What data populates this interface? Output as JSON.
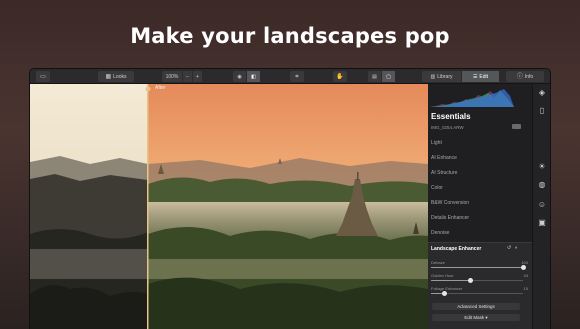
{
  "headline": "Make your landscapes pop",
  "toolbar": {
    "looks": "Looks",
    "zoom": "100%",
    "zoom_out": "−",
    "zoom_in": "+",
    "library": "Library",
    "edit": "Edit",
    "info": "Info"
  },
  "photo": {
    "before": "Before",
    "after": "After"
  },
  "panel": {
    "title": "Essentials",
    "filename": "IMG_0254.ARW",
    "items": [
      "Light",
      "AI Enhance",
      "AI Structure",
      "Color",
      "B&W Conversion",
      "Details Enhancer",
      "Denoise"
    ]
  },
  "enhancer": {
    "title": "Landscape Enhancer",
    "sliders": [
      {
        "label": "Dehaze",
        "value": "100",
        "fraction": 1.0
      },
      {
        "label": "Golden Hour",
        "value": "43",
        "fraction": 0.43
      },
      {
        "label": "Foliage Enhancer",
        "value": "15",
        "fraction": 0.15
      }
    ],
    "advanced": "Advanced Settings",
    "mask": "Edit Mask ▾"
  },
  "colors": {
    "accent": "#f0a34a",
    "panel": "#1f1f21",
    "toolbar": "#2b2b2d"
  }
}
